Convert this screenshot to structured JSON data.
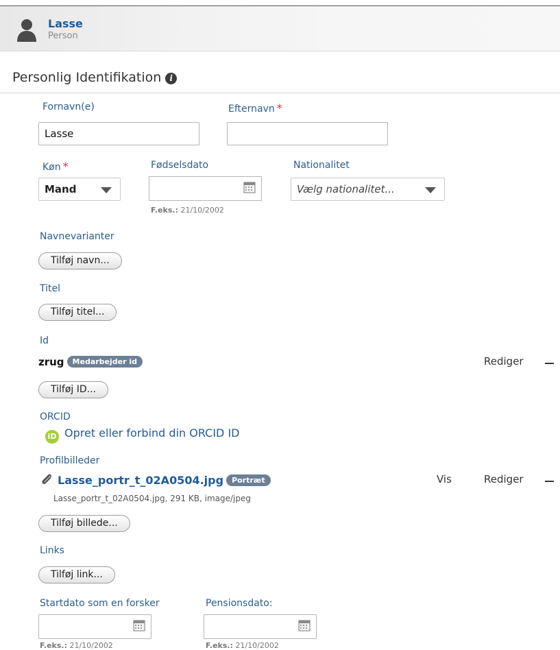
{
  "header": {
    "name": "Lasse",
    "type": "Person"
  },
  "section": {
    "title": "Personlig Identifikation",
    "info_icon": "i"
  },
  "fields": {
    "first_name": {
      "label": "Fornavn(e)",
      "value": "Lasse"
    },
    "last_name": {
      "label": "Efternavn",
      "required_mark": "*",
      "value": ""
    },
    "gender": {
      "label": "Køn",
      "required_mark": "*",
      "selected": "Mand"
    },
    "birthdate": {
      "label": "Fødselsdato",
      "value": "",
      "hint_prefix": "F.eks.:",
      "hint_value": "21/10/2002"
    },
    "nationality": {
      "label": "Nationalitet",
      "placeholder": "Vælg nationalitet..."
    }
  },
  "name_variants": {
    "label": "Navnevarianter",
    "button": "Tilføj navn..."
  },
  "title": {
    "label": "Titel",
    "button": "Tilføj titel..."
  },
  "ids": {
    "label": "Id",
    "items": [
      {
        "value": "zrug",
        "type": "Medarbejder id",
        "edit": "Rediger"
      }
    ],
    "button": "Tilføj ID..."
  },
  "orcid": {
    "label": "ORCID",
    "icon_text": "iD",
    "link": "Opret eller forbind din ORCID ID"
  },
  "profile_pictures": {
    "label": "Profilbilleder",
    "items": [
      {
        "filename": "Lasse_portr_t_02A0504.jpg",
        "badge": "Portræt",
        "meta": "Lasse_portr_t_02A0504.jpg, 291 KB, image/jpeg",
        "view": "Vis",
        "edit": "Rediger"
      }
    ],
    "button": "Tilføj billede..."
  },
  "links": {
    "label": "Links",
    "button": "Tilføj link..."
  },
  "start_date": {
    "label": "Startdato som en forsker",
    "value": "",
    "hint_prefix": "F.eks.:",
    "hint_value": "21/10/2002"
  },
  "retirement_date": {
    "label": "Pensionsdato:",
    "value": "",
    "hint_prefix": "F.eks.:",
    "hint_value": "21/10/2002"
  },
  "colors": {
    "link_blue": "#1f5c99",
    "label_blue": "#2a5d8f",
    "required_red": "#d9362e",
    "badge_gray": "#6c7f94",
    "orcid_green": "#a6ce39"
  }
}
